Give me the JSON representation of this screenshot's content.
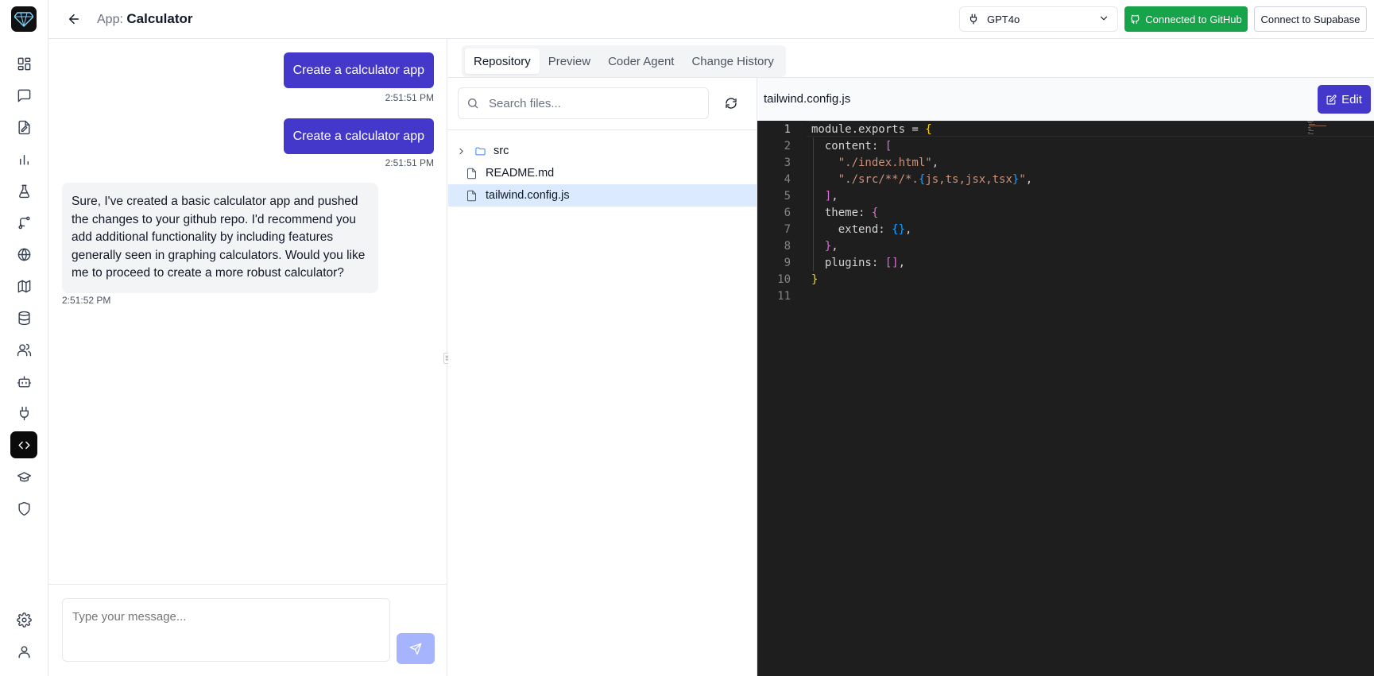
{
  "header": {
    "app_label": "App:",
    "app_name": "Calculator",
    "model": "GPT4o",
    "github_button": "Connected to GitHub",
    "supabase_button": "Connect to Supabase"
  },
  "sidebar": {
    "items": [
      {
        "icon": "dashboard-icon"
      },
      {
        "icon": "chat-icon"
      },
      {
        "icon": "document-edit-icon"
      },
      {
        "icon": "bar-chart-icon"
      },
      {
        "icon": "flask-icon"
      },
      {
        "icon": "git-branch-icon"
      },
      {
        "icon": "globe-icon"
      },
      {
        "icon": "map-icon"
      },
      {
        "icon": "database-icon"
      },
      {
        "icon": "users-icon"
      },
      {
        "icon": "bot-icon"
      },
      {
        "icon": "plug-icon"
      },
      {
        "icon": "code-icon",
        "active": true
      },
      {
        "icon": "graduation-cap-icon"
      },
      {
        "icon": "shield-icon"
      }
    ],
    "bottom": [
      {
        "icon": "settings-icon"
      },
      {
        "icon": "user-icon"
      }
    ]
  },
  "chat": {
    "messages": [
      {
        "role": "user",
        "text": "Create a calculator app",
        "time": "2:51:51 PM"
      },
      {
        "role": "user",
        "text": "Create a calculator app",
        "time": "2:51:51 PM"
      },
      {
        "role": "assistant",
        "text": "Sure, I've created a basic calculator app and pushed the changes to your github repo. I'd recommend you add additional functionality by including features generally seen in graphing calculators. Would you like me to proceed to create a more robust calculator?",
        "time": "2:51:52 PM"
      }
    ],
    "input_placeholder": "Type your message..."
  },
  "tabs": [
    "Repository",
    "Preview",
    "Coder Agent",
    "Change History"
  ],
  "active_tab": "Repository",
  "file_tree": {
    "search_placeholder": "Search files...",
    "items": [
      {
        "name": "src",
        "type": "folder"
      },
      {
        "name": "README.md",
        "type": "file"
      },
      {
        "name": "tailwind.config.js",
        "type": "file",
        "selected": true
      }
    ]
  },
  "editor": {
    "filename": "tailwind.config.js",
    "edit_label": "Edit",
    "line_numbers": [
      "1",
      "2",
      "3",
      "4",
      "5",
      "6",
      "7",
      "8",
      "9",
      "10",
      "11"
    ]
  },
  "colors": {
    "accent": "#4338ca",
    "github_green": "#16a34a",
    "editor_bg": "#1e1e1e"
  }
}
